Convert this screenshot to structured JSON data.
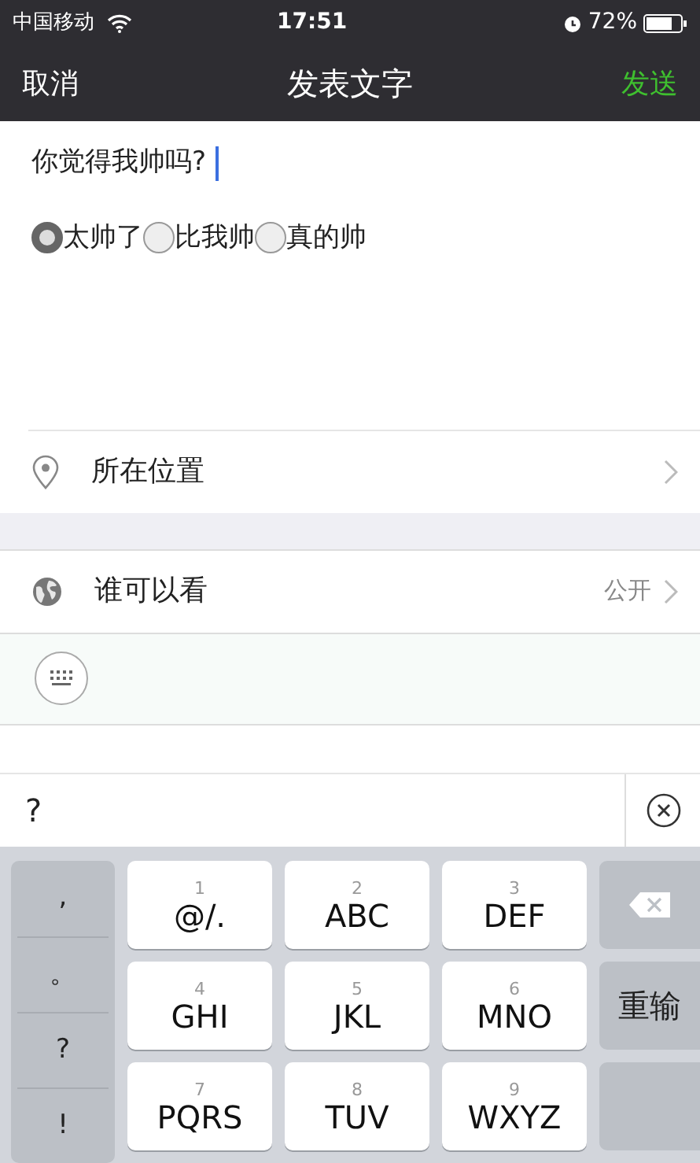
{
  "status_bar": {
    "carrier": "中国移动",
    "time": "17:51",
    "battery": "72%"
  },
  "nav": {
    "cancel": "取消",
    "title": "发表文字",
    "send": "发送"
  },
  "post": {
    "text": "你觉得我帅吗?"
  },
  "options": [
    {
      "label": "太帅了",
      "selected": true
    },
    {
      "label": "比我帅",
      "selected": false
    },
    {
      "label": "真的帅",
      "selected": false
    }
  ],
  "rows": [
    {
      "kind": "location",
      "label": "所在位置"
    },
    {
      "kind": "visibility",
      "label": "谁可以看",
      "value": "公开"
    }
  ],
  "input": {
    "value": "?"
  },
  "keyboard": {
    "punctuation": [
      ",",
      "。",
      "?",
      "!"
    ],
    "keys": [
      {
        "digit": "1",
        "letters": "@/."
      },
      {
        "digit": "2",
        "letters": "ABC"
      },
      {
        "digit": "3",
        "letters": "DEF"
      },
      {
        "digit": "4",
        "letters": "GHI"
      },
      {
        "digit": "5",
        "letters": "JKL"
      },
      {
        "digit": "6",
        "letters": "MNO"
      },
      {
        "digit": "7",
        "letters": "PQRS"
      },
      {
        "digit": "8",
        "letters": "TUV"
      },
      {
        "digit": "9",
        "letters": "WXYZ"
      }
    ],
    "retype": "重输"
  }
}
